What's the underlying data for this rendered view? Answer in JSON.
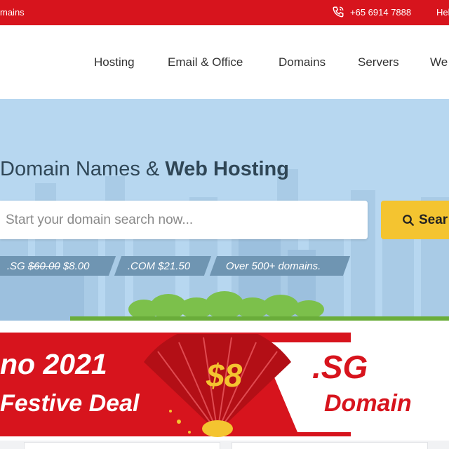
{
  "topbar": {
    "left_text": "mains",
    "phone": "+65 6914 7888",
    "help": "Help"
  },
  "nav": {
    "items": [
      {
        "label": "Hosting"
      },
      {
        "label": "Email & Office"
      },
      {
        "label": "Domains"
      },
      {
        "label": "Servers"
      },
      {
        "label": "We"
      }
    ]
  },
  "hero": {
    "title_regular": "Domain Names & ",
    "title_bold": "Web Hosting",
    "search_placeholder": "Start your domain search now...",
    "search_button": "Sear",
    "tags": [
      {
        "tld": ".SG",
        "old_price": "$60.00",
        "price": "$8.00"
      },
      {
        "tld": ".COM",
        "price": "$21.50"
      },
      {
        "text": "Over 500+ domains."
      }
    ]
  },
  "promo": {
    "line1": "no 2021",
    "line2": "Festive Deal",
    "price": "$8",
    "tld": ".SG",
    "domain_word": "Domain"
  },
  "colors": {
    "brand_red": "#d7141d",
    "accent_yellow": "#f4c430",
    "hero_sky": "#b7d7f0",
    "tag_blue": "#6f95b2"
  }
}
